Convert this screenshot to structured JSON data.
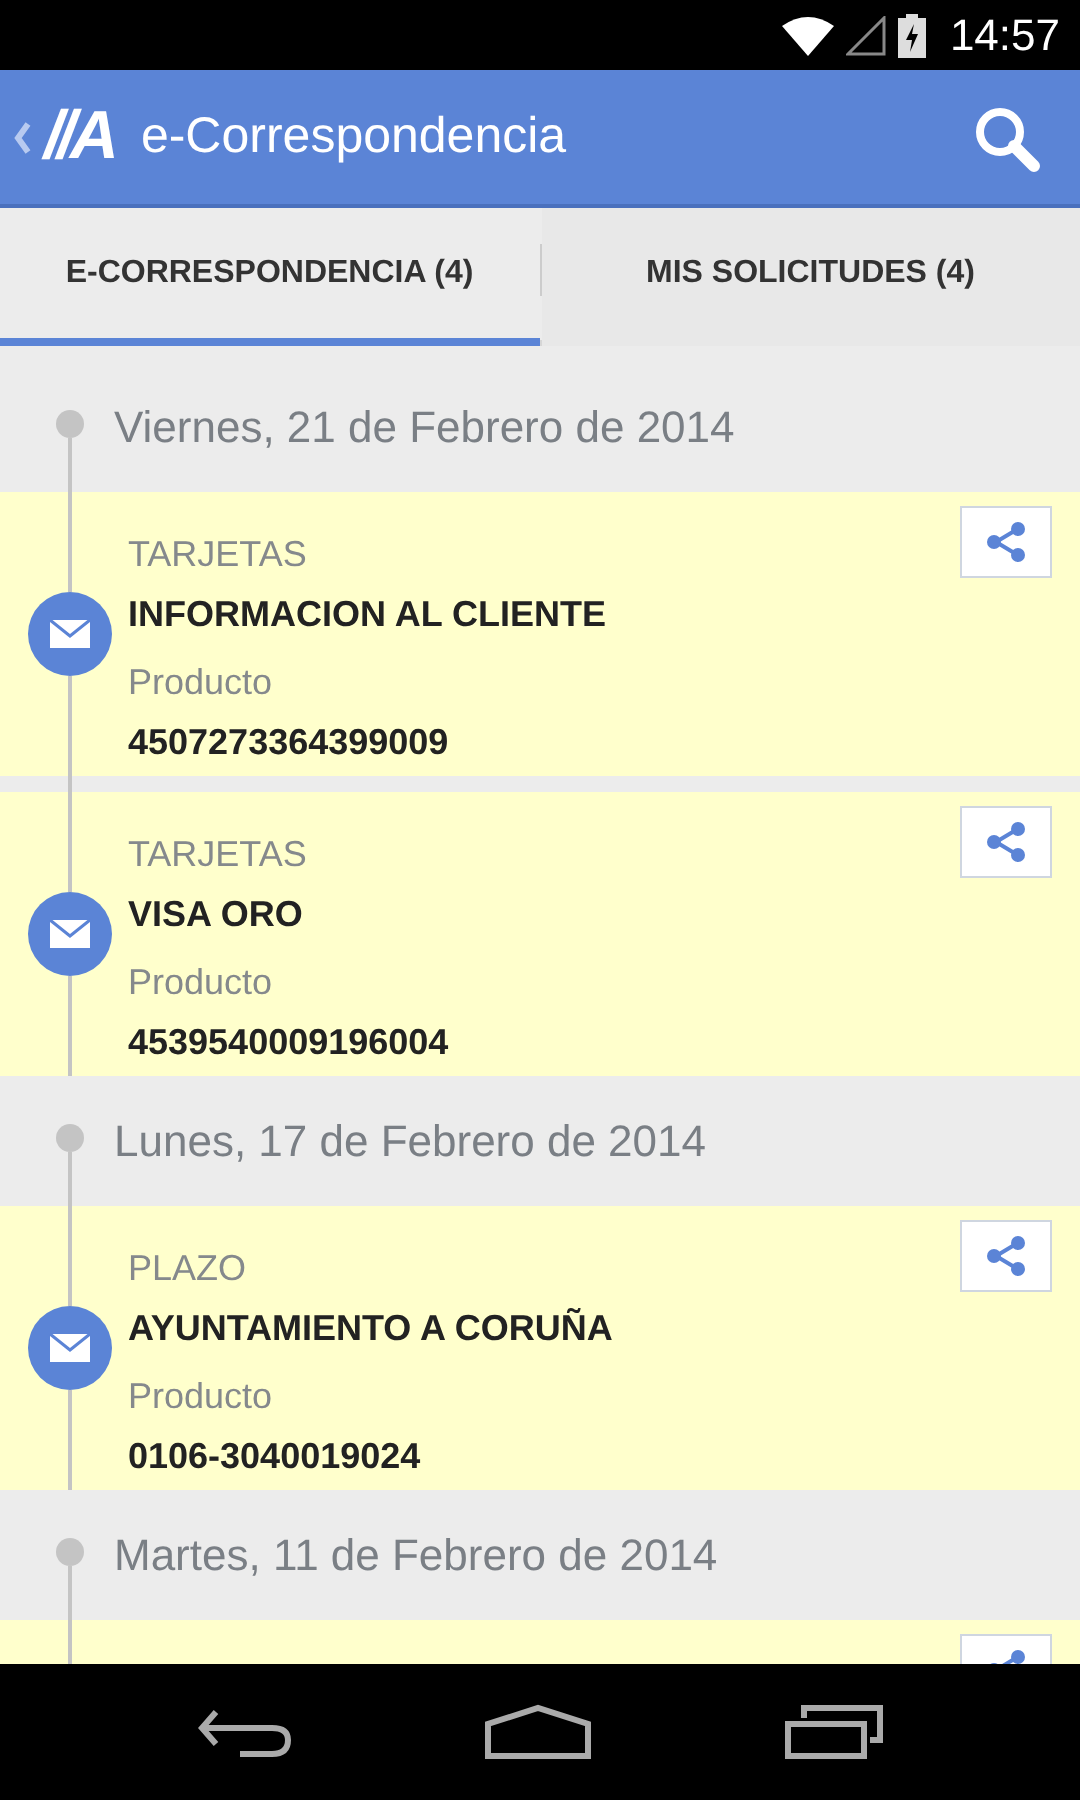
{
  "status_bar": {
    "time": "14:57"
  },
  "app_bar": {
    "logo": "//A",
    "title": "e-Correspondencia"
  },
  "tabs": [
    {
      "label": "E-CORRESPONDENCIA (4)",
      "selected": true
    },
    {
      "label": "MIS SOLICITUDES (4)",
      "selected": false
    }
  ],
  "groups": [
    {
      "date": "Viernes, 21 de Febrero de 2014",
      "cards": [
        {
          "kind": "full",
          "category": "TARJETAS",
          "title": "INFORMACION AL CLIENTE",
          "field_label": "Producto",
          "field_value": "4507273364399009"
        },
        {
          "kind": "full",
          "category": "TARJETAS",
          "title": "VISA ORO",
          "field_label": "Producto",
          "field_value": "4539540009196004"
        }
      ]
    },
    {
      "date": "Lunes, 17 de Febrero de 2014",
      "cards": [
        {
          "kind": "full",
          "category": "PLAZO",
          "title": "AYUNTAMIENTO A CORUÑA",
          "field_label": "Producto",
          "field_value": "0106-3040019024"
        }
      ]
    },
    {
      "date": "Martes, 11 de Febrero de 2014",
      "cards": [
        {
          "kind": "cut"
        }
      ]
    }
  ]
}
